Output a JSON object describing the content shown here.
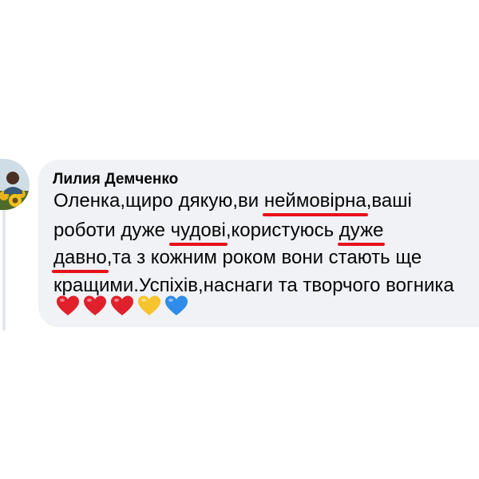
{
  "comment": {
    "author": "Лилия Демченко",
    "lines": [
      [
        {
          "text": "Оленка,щиро дякую,ви ",
          "u": false
        },
        {
          "text": "неймовірна",
          "u": true
        },
        {
          "text": ",ваші",
          "u": false
        }
      ],
      [
        {
          "text": "роботи дуже ",
          "u": false
        },
        {
          "text": "чудові",
          "u": true
        },
        {
          "text": ",користуюсь ",
          "u": false
        },
        {
          "text": "дуже",
          "u": true
        }
      ],
      [
        {
          "text": "давно",
          "u": true
        },
        {
          "text": ",та з кожним роком вони стають ще",
          "u": false
        }
      ],
      [
        {
          "text": "кращими.Успіхів,наснаги та творчого вогника",
          "u": false
        }
      ]
    ],
    "hearts": [
      {
        "name": "red-heart-icon",
        "color": "#e0202b"
      },
      {
        "name": "red-heart-icon",
        "color": "#e0202b"
      },
      {
        "name": "red-heart-icon",
        "color": "#e0202b"
      },
      {
        "name": "yellow-heart-icon",
        "color": "#f6c42c"
      },
      {
        "name": "blue-heart-icon",
        "color": "#2f8ce8"
      }
    ]
  },
  "colors": {
    "bubble": "#f0f2f5",
    "underline": "#e8101a",
    "text": "#050505"
  }
}
